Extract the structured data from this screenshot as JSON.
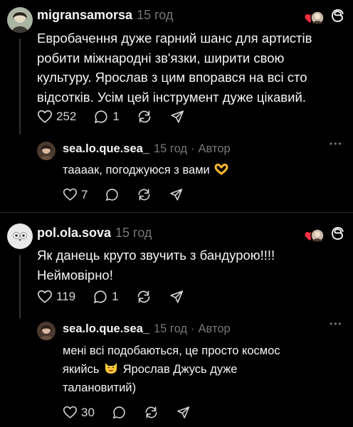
{
  "posts": [
    {
      "username": "migransamorsa",
      "time": "15 год",
      "text_lines": [
        "Евробачення дуже гарний шанс для артистів",
        "робити міжнародні зв'язки, ширити свою",
        "культуру. Ярослав з цим впорався на всі сто",
        "відсотків. Усім цей інструмент дуже цікавий."
      ],
      "likes": "252",
      "replies": "1",
      "reply": {
        "username": "sea.lo.que.sea_",
        "time": "15 год",
        "separator": "·",
        "author_label": "Автор",
        "text_lines": [
          "тааaaк, погоджуюся з вами"
        ],
        "likes": "7",
        "more": "•••"
      }
    },
    {
      "username": "pol.ola.sova",
      "time": "15 год",
      "text_lines": [
        "Як данець круто звучить з бандурою!!!!",
        "Неймовірно!"
      ],
      "likes": "119",
      "replies": "1",
      "reply": {
        "username": "sea.lo.que.sea_",
        "time": "15 год",
        "separator": "·",
        "author_label": "Автор",
        "text_lines": [
          "мені всі подобаються, це просто космос",
          "якийсь",
          "Ярослав Джусь дуже",
          "талановитий)"
        ],
        "likes": "30",
        "more": "•••"
      }
    }
  ],
  "icons": {
    "like": "heart-icon",
    "comment": "comment-icon",
    "repost": "repost-icon",
    "share": "share-icon",
    "threads": "threads-logo-icon",
    "liked_by_author": "liked-by-author-icon"
  },
  "colors": {
    "background": "#000000",
    "text": "#f3f5f7",
    "muted": "#777777",
    "heart_red": "#ff3040"
  }
}
